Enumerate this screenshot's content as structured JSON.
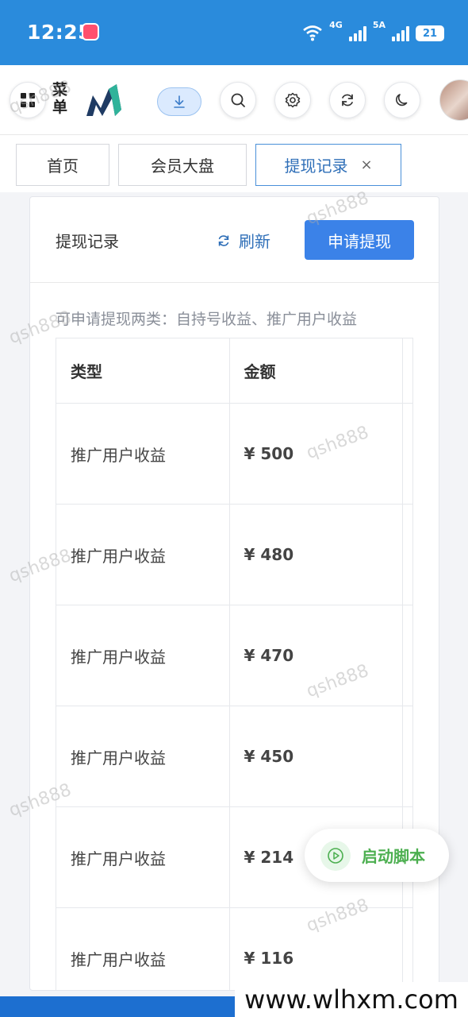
{
  "status_bar": {
    "time": "12:25",
    "net1": "4G",
    "net2": "5A",
    "battery": "21"
  },
  "topbar": {
    "menu_label": "菜单"
  },
  "tabs": [
    {
      "label": "首页"
    },
    {
      "label": "会员大盘"
    },
    {
      "label": "提现记录",
      "close": "×"
    }
  ],
  "card": {
    "title": "提现记录",
    "refresh_label": "刷新",
    "apply_label": "申请提现",
    "hint": "可申请提现两类：自持号收益、推广用户收益"
  },
  "table": {
    "headers": [
      "类型",
      "金额"
    ],
    "rows": [
      {
        "type": "推广用户收益",
        "amount": "¥ 500"
      },
      {
        "type": "推广用户收益",
        "amount": "¥ 480"
      },
      {
        "type": "推广用户收益",
        "amount": "¥ 470"
      },
      {
        "type": "推广用户收益",
        "amount": "¥ 450"
      },
      {
        "type": "推广用户收益",
        "amount": "¥ 214"
      },
      {
        "type": "推广用户收益",
        "amount": "¥ 116"
      }
    ]
  },
  "float_button": {
    "label": "启动脚本"
  },
  "watermarks": {
    "text": "qsh888",
    "site": "www.wlhxm.com"
  },
  "colors": {
    "status_bar": "#2a8bdc",
    "accent": "#3b82e8",
    "start_green": "#4caf50"
  }
}
